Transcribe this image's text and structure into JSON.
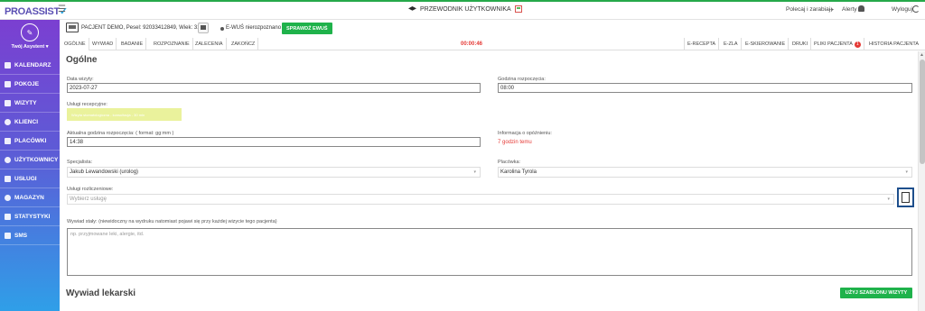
{
  "app": {
    "logo": "PROASSIST",
    "guide_label": "PRZEWODNIK UŻYTKOWNIKA",
    "refer_label": "Polecaj i zarabiaj",
    "alerts_label": "Alerty",
    "logout_label": "Wyloguj"
  },
  "sidebar": {
    "profile_name": "Twój Asystent ▾",
    "items": [
      {
        "label": "KALENDARZ"
      },
      {
        "label": "POKOJE"
      },
      {
        "label": "WIZYTY"
      },
      {
        "label": "KLIENCI"
      },
      {
        "label": "PLACÓWKI"
      },
      {
        "label": "UŻYTKOWNICY"
      },
      {
        "label": "USŁUGI"
      },
      {
        "label": "MAGAZYN"
      },
      {
        "label": "STATYSTYKI"
      },
      {
        "label": "SMS"
      }
    ]
  },
  "patient": {
    "info": "PACJENT DEMO, Pesel: 92033412849, Wiek: 31",
    "ewus_status": "E-WUŚ nierozpoznano",
    "check_button": "SPRAWDŹ EWUŚ"
  },
  "tabs": {
    "left": [
      "OGÓLNE",
      "WYWIAD",
      "BADANIE",
      "ROZPOZNANIE",
      "ZALECENIA",
      "ZAKOŃCZ"
    ],
    "timer": "00:00:46",
    "right": [
      "E-RECEPTA",
      "E-ZLA",
      "E-SKIEROWANIE",
      "DRUKI",
      "PLIKI PACJENTA",
      "HISTORIA PACJENTA"
    ],
    "files_badge": "1"
  },
  "form": {
    "section_title": "Ogólne",
    "visit_date_label": "Data wizyty:",
    "visit_date": "2023-07-27",
    "start_time_label": "Godzina rozpoczęcia:",
    "start_time": "08:00",
    "reception_services_label": "Usługi recepcyjne:",
    "reception_service_chip": "Wizyta stomatologiczna - konsultacja - 30 min",
    "current_start_label": "Aktualna godzina rozpoczęcia: ( format: gg:mm )",
    "current_start": "14:38",
    "delay_label": "Informacja o opóźnieniu:",
    "delay_value": "7 godzin temu",
    "specialist_label": "Specjalista:",
    "specialist": "Jakub Lewandowski (urolog)",
    "facility_label": "Placówka:",
    "facility": "Karolina Tyrola",
    "billing_label": "Usługi rozliczeniowe:",
    "billing_placeholder": "Wybierz usługę",
    "interview_label": "Wywiad stały: (niewidoczny na wydruku natomiast pojawi się przy każdej wizycie tego pacjenta)",
    "interview_placeholder": "np. przyjmowane leki, alergie, itd.",
    "medical_interview_title": "Wywiad lekarski",
    "template_button": "UŻYJ SZABLONU WIZYTY"
  }
}
